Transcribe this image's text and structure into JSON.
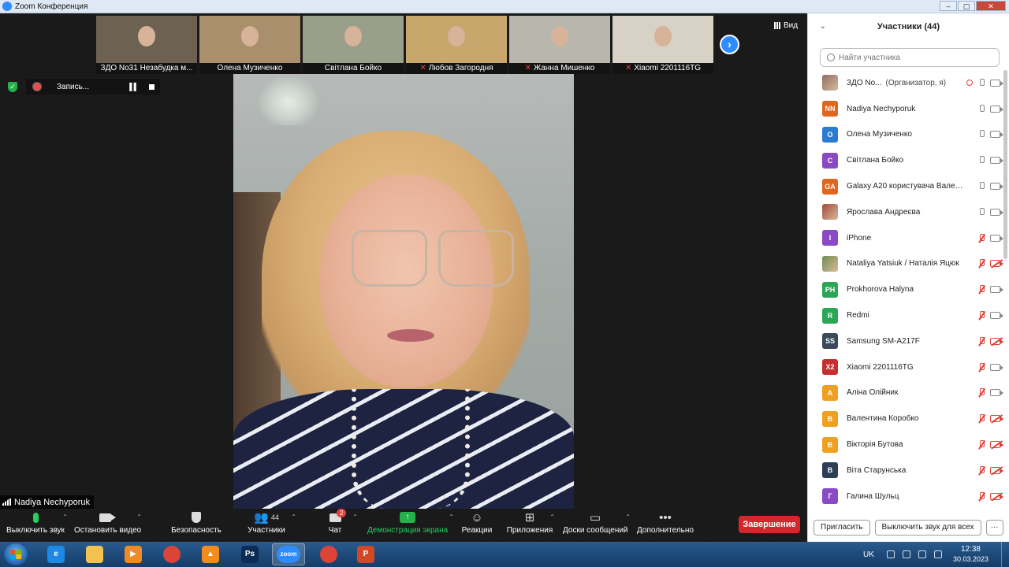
{
  "window": {
    "title": "Zoom Конференция"
  },
  "thumbnails": [
    {
      "name": "ЗДО No31 Незабудка м...",
      "muted": false,
      "bg": "#6d6152"
    },
    {
      "name": "Олена Музиченко",
      "muted": false,
      "bg": "#a98f6c"
    },
    {
      "name": "Світлана Бойко",
      "muted": false,
      "bg": "#9a9f8c"
    },
    {
      "name": "Любов Загородня",
      "muted": true,
      "bg": "#c7a76b"
    },
    {
      "name": "Жанна  Мишенко",
      "muted": true,
      "bg": "#b9b6ad"
    },
    {
      "name": "Xiaomi 2201116TG",
      "muted": true,
      "bg": "#d8d1c5"
    }
  ],
  "view_button": "Вид",
  "recording": {
    "label": "Запись..."
  },
  "active_speaker": "Nadiya Nechyporuk",
  "toolbar": {
    "mute": "Выключить звук",
    "video": "Остановить видео",
    "security": "Безопасность",
    "participants": "Участники",
    "participants_count": "44",
    "chat": "Чат",
    "chat_badge": "2",
    "share": "Демонстрация экрана",
    "reactions": "Реакции",
    "apps": "Приложения",
    "whiteboards": "Доски сообщений",
    "more": "Дополнительно",
    "end": "Завершение"
  },
  "panel": {
    "title": "Участники (44)",
    "search_placeholder": "Найти участника",
    "invite": "Пригласить",
    "mute_all": "Выключить звук для всех",
    "more": "···"
  },
  "participants": [
    {
      "initials": "",
      "photo": true,
      "color": "#8d6e63",
      "name": "ЗДО No...",
      "role": "(Организатор, я)",
      "recording": true,
      "mic": "on",
      "cam": "on"
    },
    {
      "initials": "NN",
      "color": "#e0651e",
      "name": "Nadiya Nechyporuk",
      "mic": "on",
      "cam": "on"
    },
    {
      "initials": "О",
      "color": "#2b7bd0",
      "name": "Олена Музиченко",
      "mic": "on",
      "cam": "on"
    },
    {
      "initials": "С",
      "color": "#8a4ac4",
      "name": "Світлана Бойко",
      "mic": "on",
      "cam": "on"
    },
    {
      "initials": "GA",
      "color": "#e0651e",
      "name": "Galaxy A20 користувача Вален...",
      "mic": "on",
      "cam": "on"
    },
    {
      "initials": "",
      "photo": true,
      "color": "#a04a3a",
      "name": "Ярослава Андреєва",
      "mic": "on",
      "cam": "on"
    },
    {
      "initials": "I",
      "color": "#8a4ac4",
      "name": "iPhone",
      "mic": "off",
      "cam": "on"
    },
    {
      "initials": "",
      "photo": true,
      "color": "#6b8e4e",
      "name": "Nataliya Yatsiuk / Наталія Яцюк",
      "mic": "off",
      "cam": "off"
    },
    {
      "initials": "PH",
      "color": "#2aa655",
      "name": "Prokhorova Halyna",
      "mic": "off",
      "cam": "on"
    },
    {
      "initials": "R",
      "color": "#2aa655",
      "name": "Redmi",
      "mic": "off",
      "cam": "on"
    },
    {
      "initials": "SS",
      "color": "#3a4a5a",
      "name": "Samsung SM-A217F",
      "mic": "off",
      "cam": "off"
    },
    {
      "initials": "X2",
      "color": "#c62f2f",
      "name": "Xiaomi 2201116TG",
      "mic": "off",
      "cam": "on"
    },
    {
      "initials": "А",
      "color": "#f0a020",
      "name": "Аліна Олійник",
      "mic": "off",
      "cam": "on"
    },
    {
      "initials": "В",
      "color": "#f0a020",
      "name": "Валентина Коробко",
      "mic": "off",
      "cam": "off"
    },
    {
      "initials": "В",
      "color": "#f0a020",
      "name": "Вікторія Бутова",
      "mic": "off",
      "cam": "off"
    },
    {
      "initials": "В",
      "color": "#2e3f55",
      "name": "Віта Старунська",
      "mic": "off",
      "cam": "off"
    },
    {
      "initials": "Г",
      "color": "#8a4ac4",
      "name": "Галина Шульц",
      "mic": "off",
      "cam": "off"
    }
  ],
  "taskbar": {
    "apps": [
      {
        "icon": "ie-icon",
        "glyph": "e",
        "color": "#1e88e5",
        "active": false
      },
      {
        "icon": "folder-icon",
        "glyph": "",
        "color": "#f2c14e",
        "active": false
      },
      {
        "icon": "media-player-icon",
        "glyph": "▶",
        "color": "#f08a24",
        "active": false
      },
      {
        "icon": "chrome-icon",
        "glyph": "",
        "color": "#db4437",
        "active": false
      },
      {
        "icon": "vlc-icon",
        "glyph": "▲",
        "color": "#f28c1b",
        "active": false
      },
      {
        "icon": "photoshop-icon",
        "glyph": "Ps",
        "color": "#0b2d55",
        "active": false
      },
      {
        "icon": "zoom-icon",
        "glyph": "zoom",
        "color": "#2d8cff",
        "active": true
      },
      {
        "icon": "chrome-icon-2",
        "glyph": "",
        "color": "#db4437",
        "active": false
      },
      {
        "icon": "powerpoint-icon",
        "glyph": "P",
        "color": "#d24726",
        "active": false
      }
    ],
    "language": "UK",
    "time": "12:38",
    "date": "30.03.2023"
  }
}
